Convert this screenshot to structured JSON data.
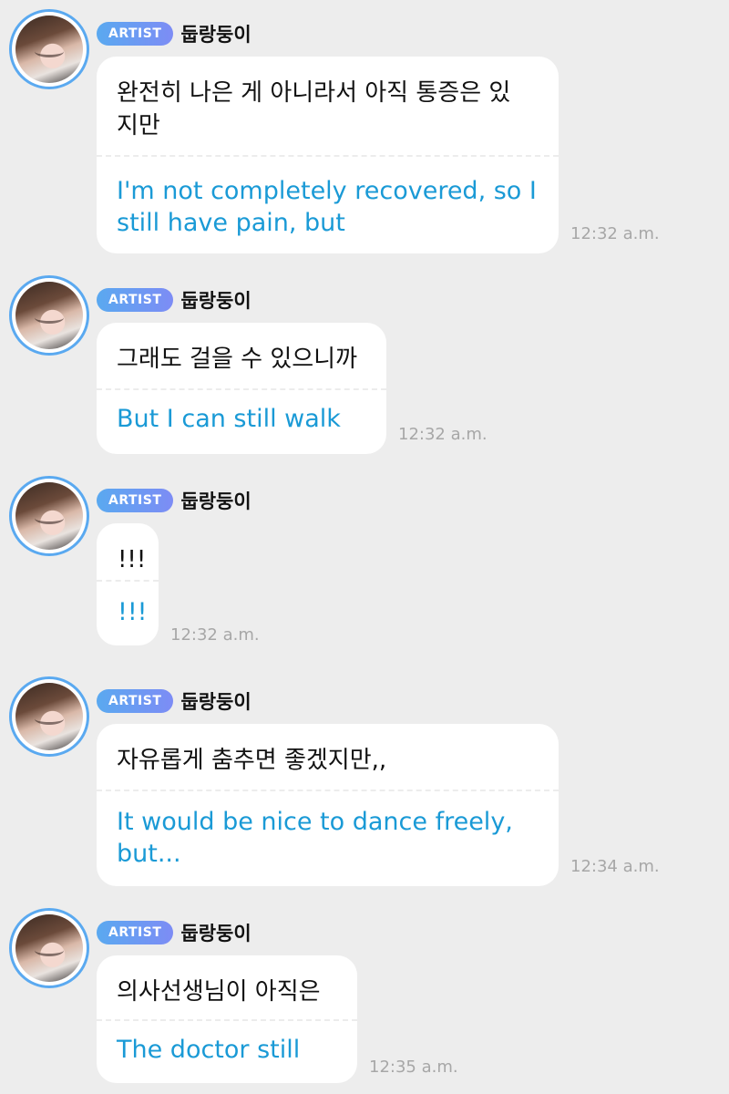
{
  "messages": [
    {
      "badge": "ARTIST",
      "sender": "둡랑둥이",
      "original": "완전히 나은 게 아니라서 아직 통증은 있지만",
      "translation": "I'm not completely recovered, so I still have pain, but",
      "time": "12:32 a.m."
    },
    {
      "badge": "ARTIST",
      "sender": "둡랑둥이",
      "original": "그래도 걸을 수 있으니까",
      "translation": "But I can still walk",
      "time": "12:32 a.m."
    },
    {
      "badge": "ARTIST",
      "sender": "둡랑둥이",
      "original": "!!!",
      "translation": "!!!",
      "time": "12:32 a.m."
    },
    {
      "badge": "ARTIST",
      "sender": "둡랑둥이",
      "original": "자유롭게 춤추면 좋겠지만,,",
      "translation": "It would be nice to dance freely, but...",
      "time": "12:34 a.m."
    },
    {
      "badge": "ARTIST",
      "sender": "둡랑둥이",
      "original": "의사선생님이 아직은",
      "translation": "The doctor still",
      "time": "12:35 a.m."
    }
  ]
}
